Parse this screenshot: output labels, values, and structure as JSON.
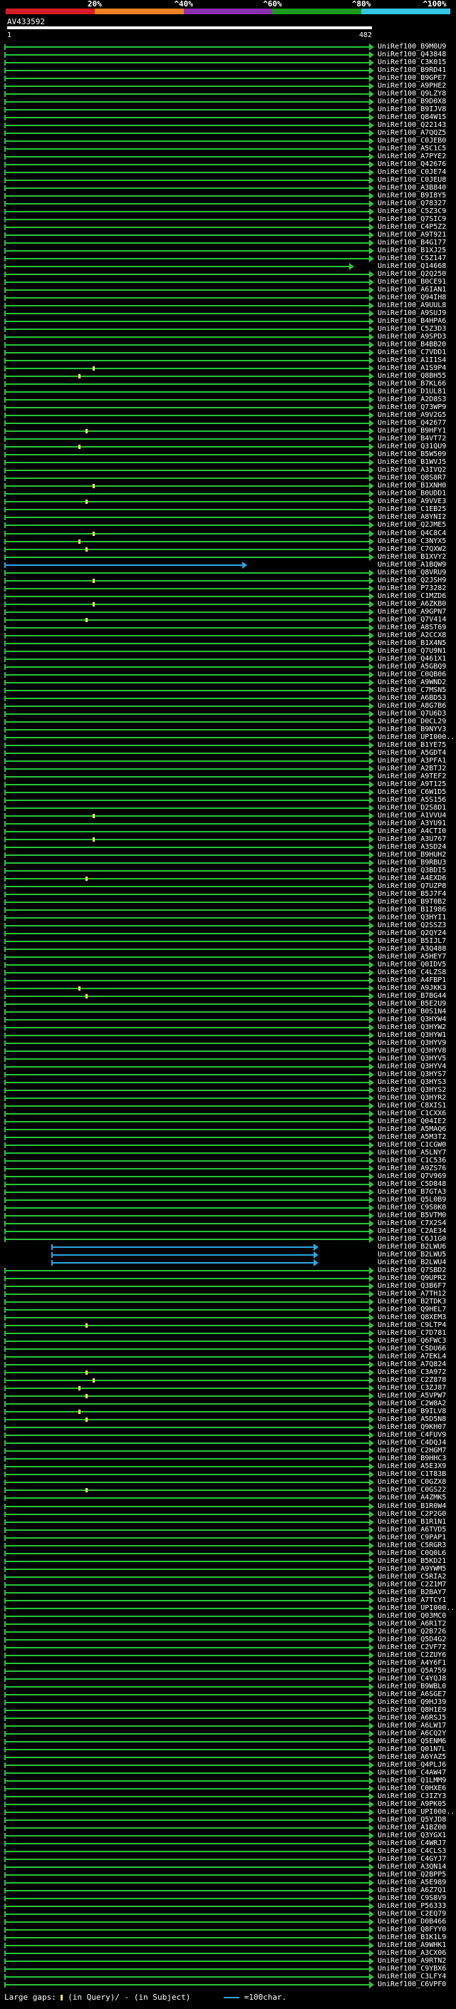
{
  "scale": {
    "labels": [
      "20%",
      "^40%",
      "^60%",
      "^80%",
      "^100%"
    ],
    "colors": [
      "#d81b24",
      "#f08020",
      "#8a2fb0",
      "#1a9a1a",
      "#33c6e8"
    ]
  },
  "query": {
    "id": "AV433592",
    "start": "1",
    "end": "482"
  },
  "colors": {
    "normal": "#29c43a",
    "highlight": "#29a5e0",
    "gap": "#ffee55",
    "background": "#000000"
  },
  "hits": [
    {
      "acc": "UniRef100_B9M0U9"
    },
    {
      "acc": "UniRef100_Q43848"
    },
    {
      "acc": "UniRef100_C3K015"
    },
    {
      "acc": "UniRef100_B9RD41"
    },
    {
      "acc": "UniRef100_B9GPE7"
    },
    {
      "acc": "UniRef100_A9PHE2"
    },
    {
      "acc": "UniRef100_Q9LZY8"
    },
    {
      "acc": "UniRef100_B9D0X8"
    },
    {
      "acc": "UniRef100_B9IJV8"
    },
    {
      "acc": "UniRef100_Q84W15"
    },
    {
      "acc": "UniRef100_Q22143"
    },
    {
      "acc": "UniRef100_A7QQZ5"
    },
    {
      "acc": "UniRef100_C0JEB0"
    },
    {
      "acc": "UniRef100_A5C1C5"
    },
    {
      "acc": "UniRef100_A7PYE2"
    },
    {
      "acc": "UniRef100_Q42676"
    },
    {
      "acc": "UniRef100_C0JE74"
    },
    {
      "acc": "UniRef100_C0JEU8"
    },
    {
      "acc": "UniRef100_A3B840"
    },
    {
      "acc": "UniRef100_B9I8Y5"
    },
    {
      "acc": "UniRef100_Q78327"
    },
    {
      "acc": "UniRef100_C5Z3C9"
    },
    {
      "acc": "UniRef100_Q7SIC9"
    },
    {
      "acc": "UniRef100_C4P5Z2"
    },
    {
      "acc": "UniRef100_A9T921"
    },
    {
      "acc": "UniRef100_B4G177"
    },
    {
      "acc": "UniRef100_B1XJ25"
    },
    {
      "acc": "UniRef100_C5Z147"
    },
    {
      "acc": "UniRef100_Q14668",
      "end": "short"
    },
    {
      "acc": "UniRef100_Q2Q250"
    },
    {
      "acc": "UniRef100_B0CE91"
    },
    {
      "acc": "UniRef100_A6IAN1"
    },
    {
      "acc": "UniRef100_Q94IH8"
    },
    {
      "acc": "UniRef100_A9UUL8"
    },
    {
      "acc": "UniRef100_A9SUJ9"
    },
    {
      "acc": "UniRef100_B4HPA6"
    },
    {
      "acc": "UniRef100_C5Z3D3"
    },
    {
      "acc": "UniRef100_A9SPD3"
    },
    {
      "acc": "UniRef100_B4BB20"
    },
    {
      "acc": "UniRef100_C7VDD1"
    },
    {
      "acc": "UniRef100_A1I1S4"
    },
    {
      "acc": "UniRef100_A1S9P4",
      "gap": true
    },
    {
      "acc": "UniRef100_Q8BH55",
      "gap": true
    },
    {
      "acc": "UniRef100_B7KL66"
    },
    {
      "acc": "UniRef100_D1UL81"
    },
    {
      "acc": "UniRef100_A2D8S3"
    },
    {
      "acc": "UniRef100_Q73WP9"
    },
    {
      "acc": "UniRef100_A9V2G5"
    },
    {
      "acc": "UniRef100_Q42677"
    },
    {
      "acc": "UniRef100_B9HFY1",
      "gap": true
    },
    {
      "acc": "UniRef100_B4VT72"
    },
    {
      "acc": "UniRef100_Q31QU9",
      "gap": true
    },
    {
      "acc": "UniRef100_B5W509"
    },
    {
      "acc": "UniRef100_B1WVJ5"
    },
    {
      "acc": "UniRef100_A3IVQ2"
    },
    {
      "acc": "UniRef100_Q8S8R7"
    },
    {
      "acc": "UniRef100_B1XNH0",
      "gap": true
    },
    {
      "acc": "UniRef100_B0UDD1"
    },
    {
      "acc": "UniRef100_A9VVE3",
      "gap": true
    },
    {
      "acc": "UniRef100_C1EB25"
    },
    {
      "acc": "UniRef100_A8YNI2"
    },
    {
      "acc": "UniRef100_Q2JME5"
    },
    {
      "acc": "UniRef100_Q4C8C4",
      "gap": true
    },
    {
      "acc": "UniRef100_C3NYX5",
      "gap": true
    },
    {
      "acc": "UniRef100_C7QXW2",
      "gap": true
    },
    {
      "acc": "UniRef100_B1XVY2"
    },
    {
      "acc": "UniRef100_A1BQW9",
      "hl": true
    },
    {
      "acc": "UniRef100_Q8VRU9"
    },
    {
      "acc": "UniRef100_Q2JSH9",
      "gap": true
    },
    {
      "acc": "UniRef100_P73282"
    },
    {
      "acc": "UniRef100_C1MZD6"
    },
    {
      "acc": "UniRef100_A6ZKB0",
      "gap": true
    },
    {
      "acc": "UniRef100_A9GPN7"
    },
    {
      "acc": "UniRef100_Q7V414",
      "gap": true
    },
    {
      "acc": "UniRef100_A8ST69"
    },
    {
      "acc": "UniRef100_A2CCX8"
    },
    {
      "acc": "UniRef100_B1X4N5"
    },
    {
      "acc": "UniRef100_Q7U9N1"
    },
    {
      "acc": "UniRef100_Q461X1"
    },
    {
      "acc": "UniRef100_A5GBQ9"
    },
    {
      "acc": "UniRef100_C0QB06"
    },
    {
      "acc": "UniRef100_A9WND2"
    },
    {
      "acc": "UniRef100_C7MSN5"
    },
    {
      "acc": "UniRef100_A6BD53"
    },
    {
      "acc": "UniRef100_A8G7B6"
    },
    {
      "acc": "UniRef100_Q7U6D3"
    },
    {
      "acc": "UniRef100_D0CL29"
    },
    {
      "acc": "UniRef100_B9NYV3"
    },
    {
      "acc": "UniRef100_UPI000..."
    },
    {
      "acc": "UniRef100_B1YE75"
    },
    {
      "acc": "UniRef100_A5GDT4"
    },
    {
      "acc": "UniRef100_A3PFA1"
    },
    {
      "acc": "UniRef100_A2BTJ2"
    },
    {
      "acc": "UniRef100_A9TEF2"
    },
    {
      "acc": "UniRef100_A9T125"
    },
    {
      "acc": "UniRef100_C6W1D5"
    },
    {
      "acc": "UniRef100_A5S156"
    },
    {
      "acc": "UniRef100_D2S8D1"
    },
    {
      "acc": "UniRef100_A1VVU4",
      "gap": true
    },
    {
      "acc": "UniRef100_A3YU91"
    },
    {
      "acc": "UniRef100_A4CTI0"
    },
    {
      "acc": "UniRef100_A3U767",
      "gap": true
    },
    {
      "acc": "UniRef100_A3SD24"
    },
    {
      "acc": "UniRef100_B9HUH2"
    },
    {
      "acc": "UniRef100_B9RBU3"
    },
    {
      "acc": "UniRef100_Q3BDI5"
    },
    {
      "acc": "UniRef100_A4EXD6",
      "gap": true
    },
    {
      "acc": "UniRef100_Q7UZP8"
    },
    {
      "acc": "UniRef100_B5J7F4"
    },
    {
      "acc": "UniRef100_B9T0B2"
    },
    {
      "acc": "UniRef100_B1I986"
    },
    {
      "acc": "UniRef100_Q3HYI1"
    },
    {
      "acc": "UniRef100_Q2SSZ3"
    },
    {
      "acc": "UniRef100_Q2QY24"
    },
    {
      "acc": "UniRef100_B5IJL7"
    },
    {
      "acc": "UniRef100_A3Q488"
    },
    {
      "acc": "UniRef100_A5HEY7"
    },
    {
      "acc": "UniRef100_Q0IDV5"
    },
    {
      "acc": "UniRef100_C4LZS8"
    },
    {
      "acc": "UniRef100_A4FBP1"
    },
    {
      "acc": "UniRef100_A9JKK3",
      "gap": true
    },
    {
      "acc": "UniRef100_B7BG44",
      "gap": true
    },
    {
      "acc": "UniRef100_B5E2U9"
    },
    {
      "acc": "UniRef100_B0S1N4"
    },
    {
      "acc": "UniRef100_Q3HYW4"
    },
    {
      "acc": "UniRef100_Q3HYW2"
    },
    {
      "acc": "UniRef100_Q3HYW1"
    },
    {
      "acc": "UniRef100_Q3HYV9"
    },
    {
      "acc": "UniRef100_Q3HYV8"
    },
    {
      "acc": "UniRef100_Q3HYV5"
    },
    {
      "acc": "UniRef100_Q3HYV4"
    },
    {
      "acc": "UniRef100_Q3HYS7"
    },
    {
      "acc": "UniRef100_Q3HYS3"
    },
    {
      "acc": "UniRef100_Q3HYS2"
    },
    {
      "acc": "UniRef100_Q3HYR2"
    },
    {
      "acc": "UniRef100_C8XIS1"
    },
    {
      "acc": "UniRef100_C1CXX6"
    },
    {
      "acc": "UniRef100_Q04IE2"
    },
    {
      "acc": "UniRef100_A5MAQ6"
    },
    {
      "acc": "UniRef100_A5M3T2"
    },
    {
      "acc": "UniRef100_C1CGW0"
    },
    {
      "acc": "UniRef100_A5LNY7"
    },
    {
      "acc": "UniRef100_C1C536"
    },
    {
      "acc": "UniRef100_A9ZS76"
    },
    {
      "acc": "UniRef100_Q7V969"
    },
    {
      "acc": "UniRef100_C5D848"
    },
    {
      "acc": "UniRef100_B7GTA3"
    },
    {
      "acc": "UniRef100_Q5L0B9"
    },
    {
      "acc": "UniRef100_C9S0K0"
    },
    {
      "acc": "UniRef100_B5VTM0"
    },
    {
      "acc": "UniRef100_C7X2S4"
    },
    {
      "acc": "UniRef100_C2AE34"
    },
    {
      "acc": "UniRef100_C6J1G0"
    },
    {
      "acc": "UniRef100_B2LWU6",
      "hlseg": true
    },
    {
      "acc": "UniRef100_B2LWU5",
      "hlseg": true
    },
    {
      "acc": "UniRef100_B2LWU4",
      "hlseg": true
    },
    {
      "acc": "UniRef100_Q7SBD2"
    },
    {
      "acc": "UniRef100_Q9UPR2"
    },
    {
      "acc": "UniRef100_Q3B6F7"
    },
    {
      "acc": "UniRef100_A7TH12"
    },
    {
      "acc": "UniRef100_B2TDK3"
    },
    {
      "acc": "UniRef100_Q9HEL7"
    },
    {
      "acc": "UniRef100_Q8XEM3"
    },
    {
      "acc": "UniRef100_C9LTP4",
      "gap": true
    },
    {
      "acc": "UniRef100_C7D781"
    },
    {
      "acc": "UniRef100_Q6FWC3"
    },
    {
      "acc": "UniRef100_C5DU66"
    },
    {
      "acc": "UniRef100_A7EKL4"
    },
    {
      "acc": "UniRef100_A7Q824"
    },
    {
      "acc": "UniRef100_C3A972",
      "gap": true
    },
    {
      "acc": "UniRef100_C2Z878",
      "gap": true
    },
    {
      "acc": "UniRef100_C3ZJ87",
      "gap": true
    },
    {
      "acc": "UniRef100_A5VPW7",
      "gap": true
    },
    {
      "acc": "UniRef100_C2W8A2"
    },
    {
      "acc": "UniRef100_B9ILV8",
      "gap": true
    },
    {
      "acc": "UniRef100_A5D5N8",
      "gap": true
    },
    {
      "acc": "UniRef100_Q9KH07"
    },
    {
      "acc": "UniRef100_C4FUV9"
    },
    {
      "acc": "UniRef100_C4DQJ4"
    },
    {
      "acc": "UniRef100_C2HGM7"
    },
    {
      "acc": "UniRef100_B9HHC3"
    },
    {
      "acc": "UniRef100_A5E3X9"
    },
    {
      "acc": "UniRef100_C1T83B"
    },
    {
      "acc": "UniRef100_C0GZX8"
    },
    {
      "acc": "UniRef100_C0GS22",
      "gap": true
    },
    {
      "acc": "UniRef100_A4ZMK5"
    },
    {
      "acc": "UniRef100_B1R0W4"
    },
    {
      "acc": "UniRef100_C2P2G0"
    },
    {
      "acc": "UniRef100_B1R1N1"
    },
    {
      "acc": "UniRef100_A6TVD5"
    },
    {
      "acc": "UniRef100_C9PAP1"
    },
    {
      "acc": "UniRef100_C5RGR3"
    },
    {
      "acc": "UniRef100_C0Q0L6"
    },
    {
      "acc": "UniRef100_B5KD21"
    },
    {
      "acc": "UniRef100_A9YWM5"
    },
    {
      "acc": "UniRef100_C5RIA2"
    },
    {
      "acc": "UniRef100_C2Z1M7"
    },
    {
      "acc": "UniRef100_B2BAY7"
    },
    {
      "acc": "UniRef100_A7TCY1"
    },
    {
      "acc": "UniRef100_UPI000..."
    },
    {
      "acc": "UniRef100_Q03MC0"
    },
    {
      "acc": "UniRef100_A6R1T2"
    },
    {
      "acc": "UniRef100_Q2B726"
    },
    {
      "acc": "UniRef100_Q5D4G2"
    },
    {
      "acc": "UniRef100_C2VF72"
    },
    {
      "acc": "UniRef100_C2ZUY6"
    },
    {
      "acc": "UniRef100_A4Y6F1"
    },
    {
      "acc": "UniRef100_Q5A759"
    },
    {
      "acc": "UniRef100_C4YQJ8"
    },
    {
      "acc": "UniRef100_B9WBL0"
    },
    {
      "acc": "UniRef100_A6SGE7"
    },
    {
      "acc": "UniRef100_Q9HJ39"
    },
    {
      "acc": "UniRef100_Q8H1E9"
    },
    {
      "acc": "UniRef100_A6RSJ5"
    },
    {
      "acc": "UniRef100_A6LW17"
    },
    {
      "acc": "UniRef100_A6CQ2Y"
    },
    {
      "acc": "UniRef100_Q5ENM6"
    },
    {
      "acc": "UniRef100_Q01N7L"
    },
    {
      "acc": "UniRef100_A6YAZ5"
    },
    {
      "acc": "UniRef100_Q4PLJ6"
    },
    {
      "acc": "UniRef100_C4AW47"
    },
    {
      "acc": "UniRef100_Q1LMM9"
    },
    {
      "acc": "UniRef100_C0HXE6"
    },
    {
      "acc": "UniRef100_C3IZY3"
    },
    {
      "acc": "UniRef100_A9PK05"
    },
    {
      "acc": "UniRef100_UPI000..."
    },
    {
      "acc": "UniRef100_Q5YJD8"
    },
    {
      "acc": "UniRef100_A1BZ00"
    },
    {
      "acc": "UniRef100_Q3YGX1"
    },
    {
      "acc": "UniRef100_C4WRJ7"
    },
    {
      "acc": "UniRef100_C4CLS3"
    },
    {
      "acc": "UniRef100_C4GYJ7"
    },
    {
      "acc": "UniRef100_A3QN14"
    },
    {
      "acc": "UniRef100_Q2BPP5"
    },
    {
      "acc": "UniRef100_A5E989"
    },
    {
      "acc": "UniRef100_A6Z7Q1"
    },
    {
      "acc": "UniRef100_C9S8V9"
    },
    {
      "acc": "UniRef100_P56333"
    },
    {
      "acc": "UniRef100_C2EQ79"
    },
    {
      "acc": "UniRef100_D0B466"
    },
    {
      "acc": "UniRef100_Q8FYY0"
    },
    {
      "acc": "UniRef100_B1K1L9"
    },
    {
      "acc": "UniRef100_A9WHK1"
    },
    {
      "acc": "UniRef100_A3CX06"
    },
    {
      "acc": "UniRef100_A9RTN2"
    },
    {
      "acc": "UniRef100_C9YBX6"
    },
    {
      "acc": "UniRef100_C3LFY4"
    },
    {
      "acc": "UniRef100_C6VPF0"
    }
  ],
  "legend": {
    "large_gaps": "Large gaps:",
    "in_query": "(in Query)/",
    "in_subject": "(in Subject)",
    "scale_note": "=100char."
  }
}
